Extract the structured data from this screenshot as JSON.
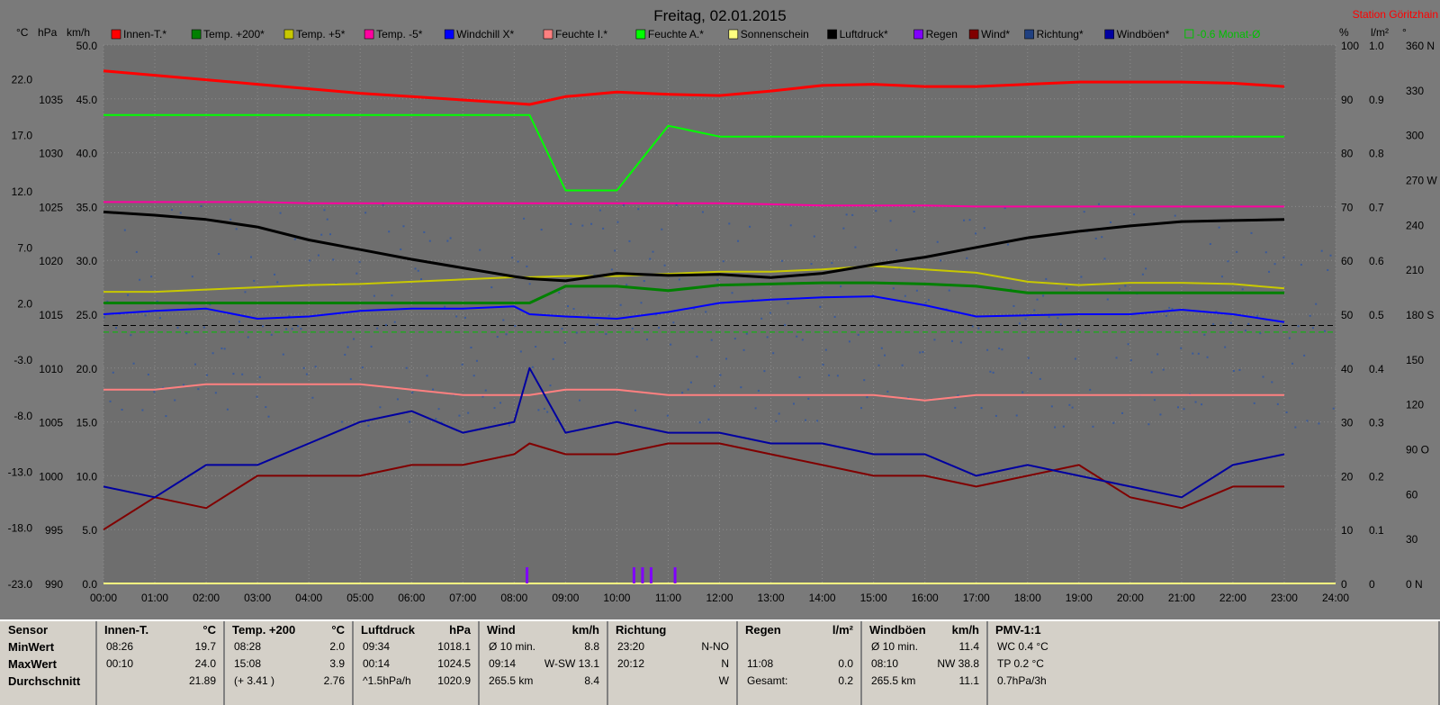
{
  "title": "Freitag, 02.01.2015",
  "station": "Station Göritzhain",
  "axes": {
    "left_units": [
      "°C",
      "hPa",
      "km/h"
    ],
    "right_units": [
      "%",
      "l/m²",
      "°"
    ],
    "temp_ticks": [
      "22.0",
      "17.0",
      "12.0",
      "7.0",
      "2.0",
      "-3.0",
      "-8.0",
      "-13.0",
      "-18.0",
      "-23.0"
    ],
    "hpa_ticks": [
      "1035",
      "1030",
      "1025",
      "1020",
      "1015",
      "1010",
      "1005",
      "1000",
      "995",
      "990"
    ],
    "kmh_ticks": [
      "50.0",
      "45.0",
      "40.0",
      "35.0",
      "30.0",
      "25.0",
      "20.0",
      "15.0",
      "10.0",
      "5.0",
      "0.0"
    ],
    "pct_ticks": [
      "100",
      "90",
      "80",
      "70",
      "60",
      "50",
      "40",
      "30",
      "20",
      "10",
      "0"
    ],
    "rain_ticks": [
      "1.0",
      "0.9",
      "0.8",
      "0.7",
      "0.6",
      "0.5",
      "0.4",
      "0.3",
      "0.2",
      "0.1",
      "0"
    ],
    "dir_ticks": [
      "360 N",
      "330",
      "300",
      "270 W",
      "240",
      "210",
      "180 S",
      "150",
      "120",
      "90 O",
      "60",
      "30",
      "0 N"
    ],
    "time_ticks": [
      "00:00",
      "01:00",
      "02:00",
      "03:00",
      "04:00",
      "05:00",
      "06:00",
      "07:00",
      "08:00",
      "09:00",
      "10:00",
      "11:00",
      "12:00",
      "13:00",
      "14:00",
      "15:00",
      "16:00",
      "17:00",
      "18:00",
      "19:00",
      "20:00",
      "21:00",
      "22:00",
      "23:00",
      "24:00"
    ]
  },
  "legend": [
    {
      "label": "Innen-T.*",
      "color": "#ff0000"
    },
    {
      "label": "Temp. +200*",
      "color": "#008000"
    },
    {
      "label": "Temp. +5*",
      "color": "#c8c800"
    },
    {
      "label": "Temp. -5*",
      "color": "#ff00a0"
    },
    {
      "label": "Windchill X*",
      "color": "#0000ff"
    },
    {
      "label": "Feuchte I.*",
      "color": "#ff8080"
    },
    {
      "label": "Feuchte A.*",
      "color": "#00ff00"
    },
    {
      "label": "Sonnenschein",
      "color": "#ffff80"
    },
    {
      "label": "Luftdruck*",
      "color": "#000000"
    },
    {
      "label": "Regen",
      "color": "#8000ff"
    },
    {
      "label": "Wind*",
      "color": "#800000"
    },
    {
      "label": "Richtung*",
      "color": "#204080"
    },
    {
      "label": "Windböen*",
      "color": "#0000a0"
    },
    {
      "label": "-0.6 Monat-Ø",
      "color": "#00c000"
    }
  ],
  "chart_data": {
    "type": "line",
    "title": "Freitag, 02.01.2015",
    "x_range": [
      "00:00",
      "24:00"
    ],
    "x_hours": [
      0,
      1,
      2,
      3,
      4,
      5,
      6,
      7,
      8,
      8.3,
      9,
      10,
      11,
      12,
      13,
      14,
      15,
      16,
      17,
      18,
      19,
      20,
      21,
      22,
      23,
      24
    ],
    "series": [
      {
        "name": "Innen-T.*",
        "unit": "°C",
        "color": "#ff0000",
        "values": [
          22.7,
          22.3,
          21.9,
          21.5,
          21.1,
          20.7,
          20.4,
          20.1,
          19.8,
          19.7,
          20.4,
          20.8,
          20.6,
          20.5,
          20.9,
          21.4,
          21.5,
          21.3,
          21.3,
          21.5,
          21.7,
          21.7,
          21.7,
          21.6,
          21.3
        ]
      },
      {
        "name": "Temp. +200*",
        "unit": "°C",
        "color": "#008000",
        "values": [
          2.0,
          2.0,
          2.0,
          2.0,
          2.0,
          2.0,
          2.0,
          2.0,
          2.0,
          2.0,
          3.5,
          3.5,
          3.1,
          3.6,
          3.7,
          3.8,
          3.8,
          3.7,
          3.5,
          2.9,
          2.9,
          2.9,
          2.9,
          2.9,
          2.9
        ]
      },
      {
        "name": "Temp. +5*",
        "unit": "°C",
        "color": "#c8c800",
        "values": [
          3.0,
          3.0,
          3.2,
          3.4,
          3.6,
          3.7,
          3.9,
          4.1,
          4.3,
          4.3,
          4.4,
          4.4,
          4.6,
          4.8,
          4.8,
          5.0,
          5.3,
          5.0,
          4.7,
          3.9,
          3.6,
          3.8,
          3.8,
          3.7,
          3.3
        ]
      },
      {
        "name": "Temp. -5*",
        "unit": "°C",
        "color": "#ff00a0",
        "values": [
          11.0,
          11.0,
          11.0,
          11.0,
          10.9,
          10.9,
          10.9,
          10.9,
          10.9,
          10.9,
          10.9,
          10.9,
          10.9,
          10.9,
          10.8,
          10.7,
          10.7,
          10.7,
          10.6,
          10.6,
          10.6,
          10.6,
          10.6,
          10.6,
          10.6
        ]
      },
      {
        "name": "Windchill X*",
        "unit": "°C",
        "color": "#0000ff",
        "values": [
          1.0,
          1.3,
          1.5,
          0.6,
          0.8,
          1.3,
          1.5,
          1.5,
          1.7,
          1.0,
          0.8,
          0.6,
          1.2,
          2.0,
          2.3,
          2.5,
          2.6,
          1.8,
          0.8,
          0.9,
          1.0,
          1.0,
          1.4,
          1.0,
          0.3
        ]
      },
      {
        "name": "Feuchte I.*",
        "unit": "%",
        "color": "#ff8080",
        "values": [
          36,
          36,
          37,
          37,
          37,
          37,
          36,
          35,
          35,
          35,
          36,
          36,
          35,
          35,
          35,
          35,
          35,
          34,
          35,
          35,
          35,
          35,
          35,
          35,
          35
        ]
      },
      {
        "name": "Feuchte A.*",
        "unit": "%",
        "color": "#00ff00",
        "values": [
          87,
          87,
          87,
          87,
          87,
          87,
          87,
          87,
          87,
          87,
          73,
          73,
          85,
          83,
          83,
          83,
          83,
          83,
          83,
          83,
          83,
          83,
          83,
          83,
          83
        ]
      },
      {
        "name": "Luftdruck*",
        "unit": "hPa",
        "color": "#000000",
        "values": [
          1024.5,
          1024.2,
          1023.8,
          1023.1,
          1021.9,
          1021.0,
          1020.1,
          1019.3,
          1018.5,
          1018.3,
          1018.1,
          1018.8,
          1018.6,
          1018.7,
          1018.4,
          1018.8,
          1019.6,
          1020.3,
          1021.2,
          1022.1,
          1022.7,
          1023.2,
          1023.6,
          1023.7,
          1023.8
        ]
      },
      {
        "name": "Wind*",
        "unit": "km/h",
        "color": "#800000",
        "values": [
          5,
          8,
          7,
          10,
          10,
          10,
          11,
          11,
          12,
          13,
          12,
          12,
          13,
          13,
          12,
          11,
          10,
          10,
          9,
          10,
          11,
          8,
          7,
          9,
          9
        ]
      },
      {
        "name": "Windböen*",
        "unit": "km/h",
        "color": "#0000a0",
        "values": [
          9,
          8,
          11,
          11,
          13,
          15,
          16,
          14,
          15,
          20,
          14,
          15,
          14,
          14,
          13,
          13,
          12,
          12,
          10,
          11,
          10,
          9,
          8,
          11,
          12
        ]
      }
    ],
    "rain_bars": [
      {
        "time": "08:15",
        "value": 0.03
      },
      {
        "time": "10:20",
        "value": 0.03
      },
      {
        "time": "10:30",
        "value": 0.03
      },
      {
        "time": "10:40",
        "value": 0.03
      },
      {
        "time": "11:08",
        "value": 0.03
      }
    ],
    "reference_lines": [
      {
        "name": "-0.6 Monat-Ø",
        "unit": "°C",
        "value": -0.6,
        "color": "#00c000",
        "style": "dashed"
      },
      {
        "name": "0",
        "unit": "°C",
        "value": 0.0,
        "color": "#000000",
        "style": "dashed"
      }
    ],
    "ylim_temp": [
      -23.0,
      25.0
    ],
    "ylim_hpa": [
      990,
      1040
    ],
    "ylim_kmh": [
      0,
      50
    ],
    "ylim_pct": [
      0,
      100
    ],
    "grid": true
  },
  "table": {
    "row_labels": [
      "Sensor",
      "MinWert",
      "MaxWert",
      "Durchschnitt"
    ],
    "columns": [
      {
        "name": "Innen-T.",
        "unit": "°C",
        "rows": [
          [
            "08:26",
            "19.7"
          ],
          [
            "00:10",
            "24.0"
          ],
          [
            "",
            "21.89"
          ]
        ]
      },
      {
        "name": "Temp. +200",
        "unit": "°C",
        "rows": [
          [
            "08:28",
            "2.0"
          ],
          [
            "15:08",
            "3.9"
          ],
          [
            "(+ 3.41 )",
            "2.76"
          ]
        ]
      },
      {
        "name": "Luftdruck",
        "unit": "hPa",
        "rows": [
          [
            "09:34",
            "1018.1"
          ],
          [
            "00:14",
            "1024.5"
          ],
          [
            "^1.5hPa/h",
            "1020.9"
          ]
        ]
      },
      {
        "name": "Wind",
        "unit": "km/h",
        "rows": [
          [
            "Ø 10 min.",
            "8.8"
          ],
          [
            "09:14",
            "W-SW 13.1"
          ],
          [
            "265.5 km",
            "8.4"
          ]
        ]
      },
      {
        "name": "Richtung",
        "unit": "",
        "rows": [
          [
            "23:20",
            "N-NO"
          ],
          [
            "20:12",
            "N"
          ],
          [
            "",
            "W"
          ]
        ]
      },
      {
        "name": "Regen",
        "unit": "l/m²",
        "rows": [
          [
            "",
            ""
          ],
          [
            "11:08",
            "0.0"
          ],
          [
            "Gesamt:",
            "0.2"
          ]
        ]
      },
      {
        "name": "Windböen",
        "unit": "km/h",
        "rows": [
          [
            "Ø 10 min.",
            "11.4"
          ],
          [
            "08:10",
            "NW 38.8"
          ],
          [
            "265.5 km",
            "11.1"
          ]
        ]
      },
      {
        "name": "PMV-1:1",
        "unit": "",
        "rows": [
          [
            "WC 0.4 °C",
            ""
          ],
          [
            "TP 0.2 °C",
            ""
          ],
          [
            "0.7hPa/3h",
            ""
          ]
        ]
      }
    ]
  }
}
